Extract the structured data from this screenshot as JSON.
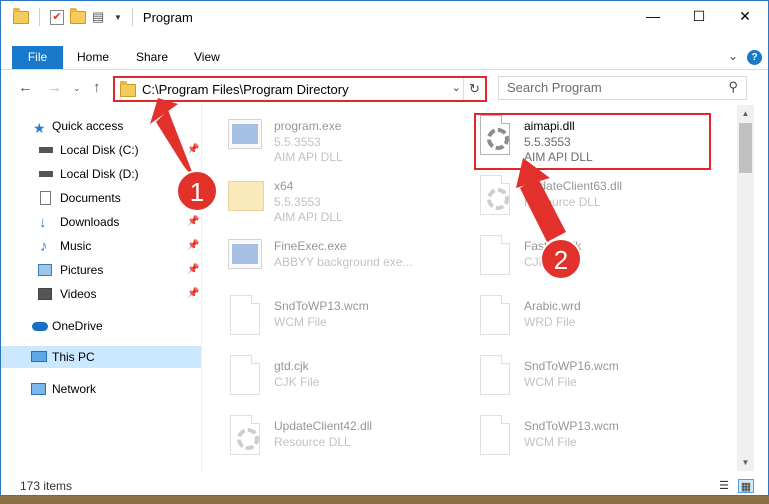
{
  "window": {
    "title": "Program",
    "controls": {
      "minimize": "—",
      "maximize": "☐",
      "close": "✕"
    }
  },
  "ribbon": {
    "tabs": [
      {
        "label": "File"
      },
      {
        "label": "Home"
      },
      {
        "label": "Share"
      },
      {
        "label": "View"
      }
    ],
    "help_label": "?"
  },
  "address": {
    "path": "C:\\Program Files\\Program Directory",
    "search_placeholder": "Search Program"
  },
  "sidebar": {
    "items": [
      {
        "label": "Quick access",
        "icon": "star-icon",
        "pinned": false
      },
      {
        "label": "Local Disk (C:)",
        "icon": "drive-icon",
        "pinned": true
      },
      {
        "label": "Local Disk (D:)",
        "icon": "drive-icon",
        "pinned": false
      },
      {
        "label": "Documents",
        "icon": "documents-icon",
        "pinned": true
      },
      {
        "label": "Downloads",
        "icon": "download-icon",
        "pinned": true
      },
      {
        "label": "Music",
        "icon": "music-icon",
        "pinned": true
      },
      {
        "label": "Pictures",
        "icon": "pictures-icon",
        "pinned": true
      },
      {
        "label": "Videos",
        "icon": "videos-icon",
        "pinned": true
      },
      {
        "label": "OneDrive",
        "icon": "cloud-icon",
        "pinned": false
      },
      {
        "label": "This PC",
        "icon": "computer-icon",
        "pinned": false,
        "selected": true
      },
      {
        "label": "Network",
        "icon": "network-icon",
        "pinned": false
      }
    ]
  },
  "files": [
    {
      "name": "program.exe",
      "line1": "5.5.3553",
      "line2": "AIM API DLL",
      "icon": "exe-icon",
      "faded": true
    },
    {
      "name": "aimapi.dll",
      "line1": "5.5.3553",
      "line2": "AIM API DLL",
      "icon": "dll-gear-icon",
      "faded": false,
      "highlighted": true
    },
    {
      "name": "x64",
      "line1": "5.5.3553",
      "line2": "AIM API DLL",
      "icon": "folder-icon",
      "faded": true
    },
    {
      "name": "UpdateClient63.dll",
      "line1": "Resource DLL",
      "line2": "",
      "icon": "dll-gear-icon",
      "faded": true
    },
    {
      "name": "FineExec.exe",
      "line1": "ABBYY background exe...",
      "line2": "",
      "icon": "app-window-icon",
      "faded": true
    },
    {
      "name": "FastFix.cjk",
      "line1": "CJK File",
      "line2": "",
      "icon": "document-icon",
      "faded": true
    },
    {
      "name": "SndToWP13.wcm",
      "line1": "WCM File",
      "line2": "",
      "icon": "document-icon",
      "faded": true
    },
    {
      "name": "Arabic.wrd",
      "line1": "WRD File",
      "line2": "",
      "icon": "document-icon",
      "faded": true
    },
    {
      "name": "gtd.cjk",
      "line1": "CJK File",
      "line2": "",
      "icon": "document-icon",
      "faded": true
    },
    {
      "name": "SndToWP16.wcm",
      "line1": "WCM File",
      "line2": "",
      "icon": "document-icon",
      "faded": true
    },
    {
      "name": "UpdateClient42.dll",
      "line1": "Resource DLL",
      "line2": "",
      "icon": "dll-gear-icon",
      "faded": true
    },
    {
      "name": "SndToWP13.wcm",
      "line1": "WCM File",
      "line2": "",
      "icon": "document-icon",
      "faded": true
    }
  ],
  "status": {
    "item_count": "173 items"
  },
  "callouts": [
    {
      "number": "1",
      "target": "address-bar"
    },
    {
      "number": "2",
      "target": "aimapi.dll"
    }
  ],
  "colors": {
    "accent": "#1979ca",
    "callout": "#e2302a",
    "selected_bg": "#cce8ff"
  }
}
